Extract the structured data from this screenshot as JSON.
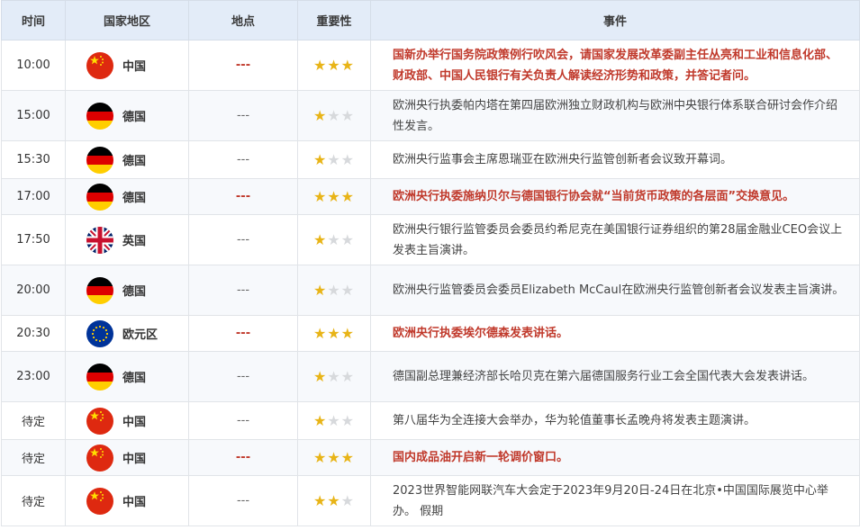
{
  "headers": {
    "time": "时间",
    "country": "国家地区",
    "location": "地点",
    "importance": "重要性",
    "event": "事件"
  },
  "colors": {
    "important_text": "#c0392b",
    "star_on": "#e8b417",
    "star_off": "#d7d9dc",
    "header_bg": "#e3ecf8"
  },
  "rows": [
    {
      "time": "10:00",
      "country": "中国",
      "flag": "china-flag-icon",
      "location": "---",
      "stars": 3,
      "important": true,
      "event": "国新办举行国务院政策例行吹风会，请国家发展改革委副主任丛亮和工业和信息化部、财政部、中国人民银行有关负责人解读经济形势和政策，并答记者问。"
    },
    {
      "time": "15:00",
      "country": "德国",
      "flag": "germany-flag-icon",
      "location": "---",
      "stars": 1,
      "important": false,
      "event": "欧洲央行执委帕内塔在第四届欧洲独立财政机构与欧洲中央银行体系联合研讨会作介绍性发言。"
    },
    {
      "time": "15:30",
      "country": "德国",
      "flag": "germany-flag-icon",
      "location": "---",
      "stars": 1,
      "important": false,
      "event": "欧洲央行监事会主席恩瑞亚在欧洲央行监管创新者会议致开幕词。"
    },
    {
      "time": "17:00",
      "country": "德国",
      "flag": "germany-flag-icon",
      "location": "---",
      "stars": 3,
      "important": true,
      "event": "欧洲央行执委施纳贝尔与德国银行协会就“当前货币政策的各层面”交换意见。"
    },
    {
      "time": "17:50",
      "country": "英国",
      "flag": "uk-flag-icon",
      "location": "---",
      "stars": 1,
      "important": false,
      "event": "欧洲央行银行监管委员会委员约希尼克在美国银行证券组织的第28届金融业CEO会议上发表主旨演讲。"
    },
    {
      "time": "20:00",
      "country": "德国",
      "flag": "germany-flag-icon",
      "location": "---",
      "stars": 1,
      "important": false,
      "event": "欧洲央行监管委员会委员Elizabeth McCaul在欧洲央行监管创新者会议发表主旨演讲。"
    },
    {
      "time": "20:30",
      "country": "欧元区",
      "flag": "eu-flag-icon",
      "location": "---",
      "stars": 3,
      "important": true,
      "event": "欧洲央行执委埃尔德森发表讲话。"
    },
    {
      "time": "23:00",
      "country": "德国",
      "flag": "germany-flag-icon",
      "location": "---",
      "stars": 1,
      "important": false,
      "event": "德国副总理兼经济部长哈贝克在第六届德国服务行业工会全国代表大会发表讲话。"
    },
    {
      "time": "待定",
      "country": "中国",
      "flag": "china-flag-icon",
      "location": "---",
      "stars": 1,
      "important": false,
      "event": "第八届华为全连接大会举办，华为轮值董事长孟晚舟将发表主题演讲。"
    },
    {
      "time": "待定",
      "country": "中国",
      "flag": "china-flag-icon",
      "location": "---",
      "stars": 3,
      "important": true,
      "event": "国内成品油开启新一轮调价窗口。"
    },
    {
      "time": "待定",
      "country": "中国",
      "flag": "china-flag-icon",
      "location": "---",
      "stars": 2,
      "important": false,
      "event": "2023世界智能网联汽车大会定于2023年9月20日-24日在北京•中国国际展览中心举办。 假期"
    }
  ]
}
